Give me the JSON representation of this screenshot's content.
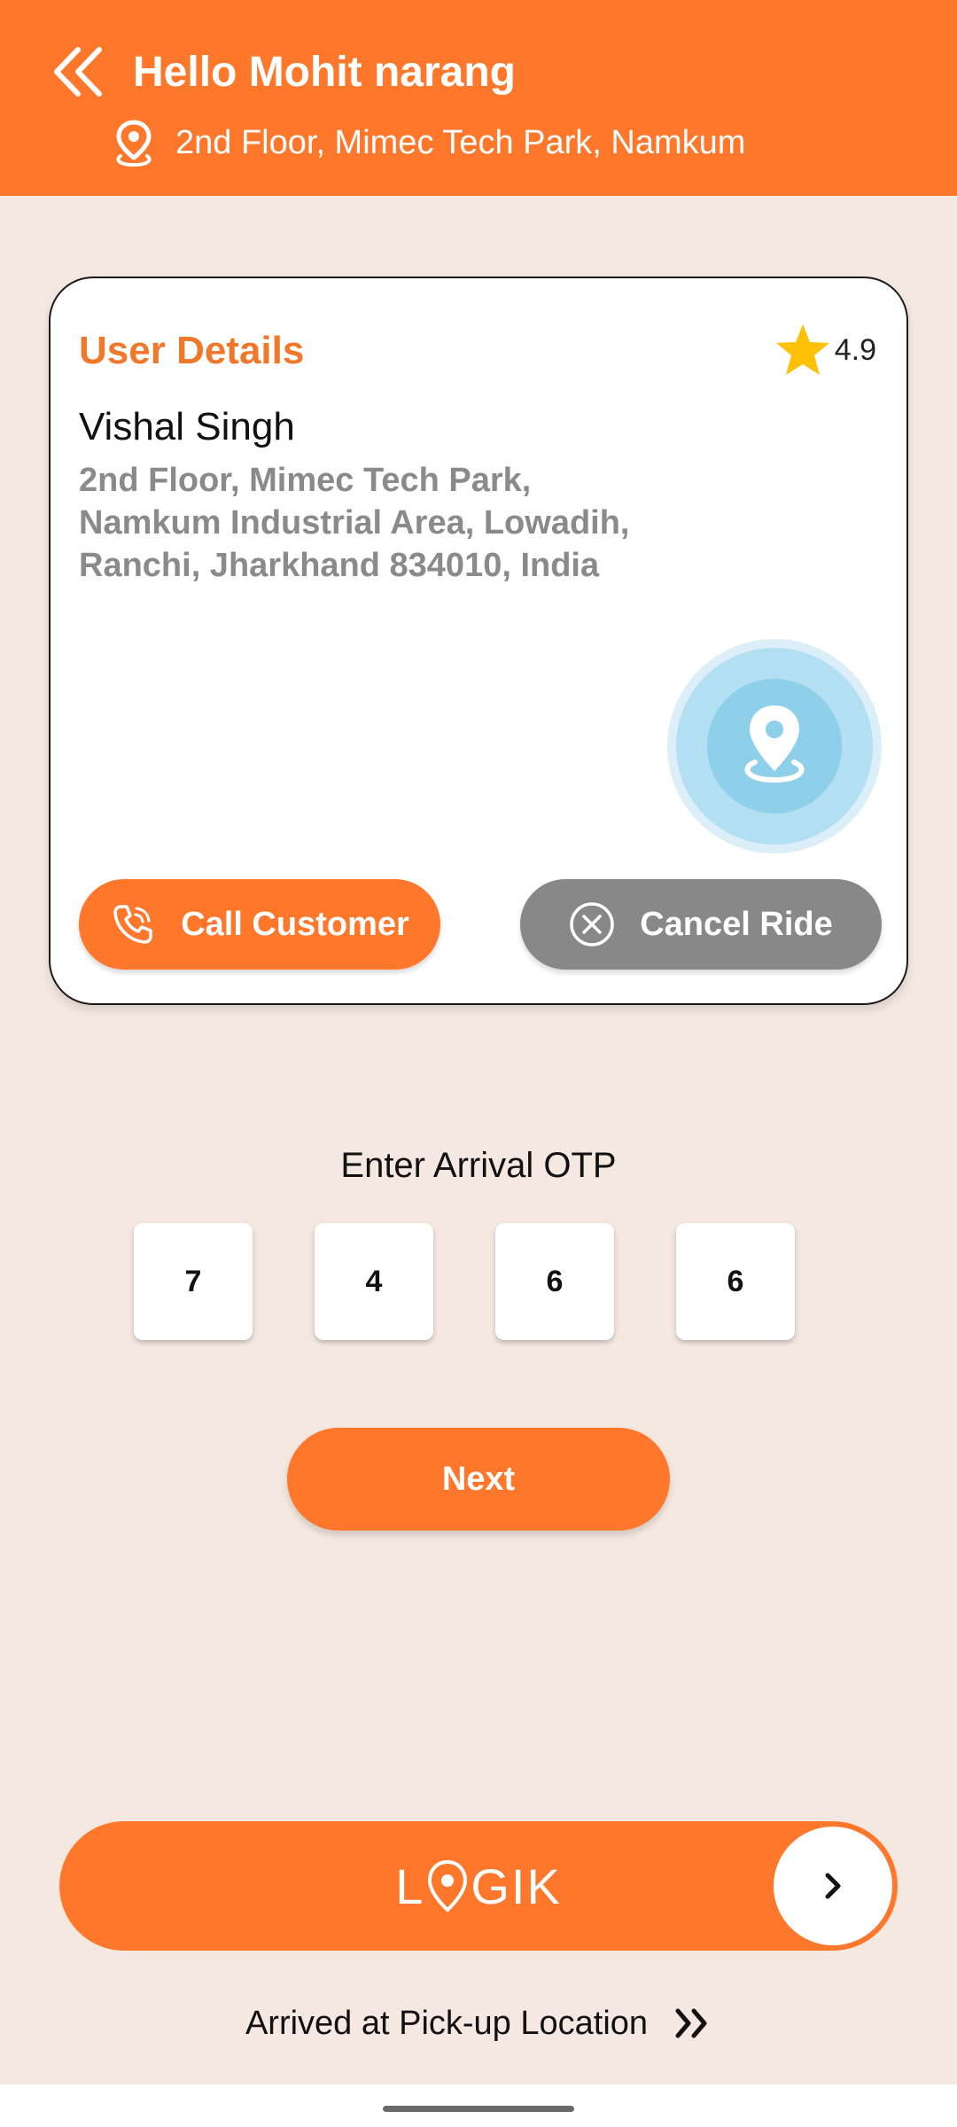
{
  "header": {
    "greeting": "Hello Mohit narang",
    "address": "2nd Floor, Mimec Tech Park, Namkum",
    "back_icon": "double-chevron-left-icon",
    "location_icon": "map-pin-icon"
  },
  "card": {
    "title": "User Details",
    "rating": "4.9",
    "rating_icon": "star-icon",
    "user_name": "Vishal Singh",
    "address_lines": [
      "2nd Floor, Mimec Tech Park,",
      "Namkum Industrial Area, Lowadih,",
      "Ranchi, Jharkhand 834010, India"
    ],
    "location_button_icon": "location-pin-icon",
    "call_label": "Call Customer",
    "call_icon": "phone-icon",
    "cancel_label": "Cancel Ride",
    "cancel_icon": "close-circle-icon"
  },
  "otp": {
    "label": "Enter Arrival OTP",
    "digits": [
      "7",
      "4",
      "6",
      "6"
    ]
  },
  "next_label": "Next",
  "slider": {
    "brand_prefix": "L",
    "brand_suffix": "GIK",
    "knob_icon": "chevron-right-icon"
  },
  "footer": {
    "label": "Arrived at Pick-up Location",
    "icon": "double-chevron-right-icon"
  },
  "colors": {
    "accent": "#FF772B",
    "background": "#F5E8E1",
    "title_orange": "#F0782B",
    "cancel_gray": "#888888",
    "star": "#FFC107",
    "pin_blue": "#8ECFEA"
  }
}
